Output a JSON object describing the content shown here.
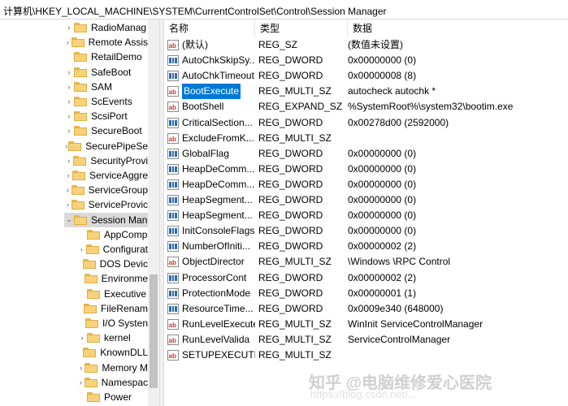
{
  "address_path": "计算机\\HKEY_LOCAL_MACHINE\\SYSTEM\\CurrentControlSet\\Control\\Session Manager",
  "tree": [
    {
      "label": "RadioManag",
      "level": 1,
      "chevron": "›"
    },
    {
      "label": "Remote Assis",
      "level": 1,
      "chevron": "›"
    },
    {
      "label": "RetailDemo",
      "level": 1,
      "chevron": ""
    },
    {
      "label": "SafeBoot",
      "level": 1,
      "chevron": "›"
    },
    {
      "label": "SAM",
      "level": 1,
      "chevron": "›"
    },
    {
      "label": "ScEvents",
      "level": 1,
      "chevron": "›"
    },
    {
      "label": "ScsiPort",
      "level": 1,
      "chevron": "›"
    },
    {
      "label": "SecureBoot",
      "level": 1,
      "chevron": "›"
    },
    {
      "label": "SecurePipeSe",
      "level": 1,
      "chevron": "›"
    },
    {
      "label": "SecurityProvi",
      "level": 1,
      "chevron": "›"
    },
    {
      "label": "ServiceAggre",
      "level": 1,
      "chevron": "›"
    },
    {
      "label": "ServiceGroup",
      "level": 1,
      "chevron": "›"
    },
    {
      "label": "ServiceProvic",
      "level": 1,
      "chevron": "›"
    },
    {
      "label": "Session Man",
      "level": 1,
      "chevron": "⌄",
      "selected": true
    },
    {
      "label": "AppComp",
      "level": 2,
      "chevron": ""
    },
    {
      "label": "Configurat",
      "level": 2,
      "chevron": "›"
    },
    {
      "label": "DOS Devic",
      "level": 2,
      "chevron": ""
    },
    {
      "label": "Environme",
      "level": 2,
      "chevron": ""
    },
    {
      "label": "Executive",
      "level": 2,
      "chevron": ""
    },
    {
      "label": "FileRenam",
      "level": 2,
      "chevron": ""
    },
    {
      "label": "I/O Systen",
      "level": 2,
      "chevron": ""
    },
    {
      "label": "kernel",
      "level": 2,
      "chevron": "›"
    },
    {
      "label": "KnownDLL",
      "level": 2,
      "chevron": ""
    },
    {
      "label": "Memory M",
      "level": 2,
      "chevron": "›"
    },
    {
      "label": "Namespac",
      "level": 2,
      "chevron": "›"
    },
    {
      "label": "Power",
      "level": 2,
      "chevron": ""
    }
  ],
  "columns": {
    "name": "名称",
    "type": "类型",
    "data": "数据"
  },
  "rows": [
    {
      "name": "(默认)",
      "type": "REG_SZ",
      "data": "(数值未设置)",
      "icon": "string-value-icon"
    },
    {
      "name": "AutoChkSkipSy...",
      "type": "REG_DWORD",
      "data": "0x00000000 (0)",
      "icon": "binary-value-icon"
    },
    {
      "name": "AutoChkTimeout",
      "type": "REG_DWORD",
      "data": "0x00000008 (8)",
      "icon": "binary-value-icon"
    },
    {
      "name": "BootExecute",
      "type": "REG_MULTI_SZ",
      "data": "autocheck autochk *",
      "icon": "string-value-icon",
      "selected": true
    },
    {
      "name": "BootShell",
      "type": "REG_EXPAND_SZ",
      "data": "%SystemRoot%\\system32\\bootim.exe",
      "icon": "string-value-icon"
    },
    {
      "name": "CriticalSection...",
      "type": "REG_DWORD",
      "data": "0x00278d00 (2592000)",
      "icon": "binary-value-icon"
    },
    {
      "name": "ExcludeFromK...",
      "type": "REG_MULTI_SZ",
      "data": "",
      "icon": "string-value-icon"
    },
    {
      "name": "GlobalFlag",
      "type": "REG_DWORD",
      "data": "0x00000000 (0)",
      "icon": "binary-value-icon"
    },
    {
      "name": "HeapDeComm...",
      "type": "REG_DWORD",
      "data": "0x00000000 (0)",
      "icon": "binary-value-icon"
    },
    {
      "name": "HeapDeComm...",
      "type": "REG_DWORD",
      "data": "0x00000000 (0)",
      "icon": "binary-value-icon"
    },
    {
      "name": "HeapSegment...",
      "type": "REG_DWORD",
      "data": "0x00000000 (0)",
      "icon": "binary-value-icon"
    },
    {
      "name": "HeapSegment...",
      "type": "REG_DWORD",
      "data": "0x00000000 (0)",
      "icon": "binary-value-icon"
    },
    {
      "name": "InitConsoleFlags",
      "type": "REG_DWORD",
      "data": "0x00000000 (0)",
      "icon": "binary-value-icon"
    },
    {
      "name": "NumberOfIniti...",
      "type": "REG_DWORD",
      "data": "0x00000002 (2)",
      "icon": "binary-value-icon"
    },
    {
      "name": "ObjectDirector",
      "type": "REG_MULTI_SZ",
      "data": "\\Windows \\RPC Control",
      "icon": "string-value-icon"
    },
    {
      "name": "ProcessorCont",
      "type": "REG_DWORD",
      "data": "0x00000002 (2)",
      "icon": "binary-value-icon"
    },
    {
      "name": "ProtectionMode",
      "type": "REG_DWORD",
      "data": "0x00000001 (1)",
      "icon": "binary-value-icon"
    },
    {
      "name": "ResourceTime...",
      "type": "REG_DWORD",
      "data": "0x0009e340 (648000)",
      "icon": "binary-value-icon"
    },
    {
      "name": "RunLevelExecute",
      "type": "REG_MULTI_SZ",
      "data": "WinInit ServiceControlManager",
      "icon": "string-value-icon"
    },
    {
      "name": "RunLevelValida",
      "type": "REG_MULTI_SZ",
      "data": "ServiceControlManager",
      "icon": "string-value-icon"
    },
    {
      "name": "SETUPEXECUTE",
      "type": "REG_MULTI_SZ",
      "data": "",
      "icon": "string-value-icon"
    }
  ],
  "watermark": {
    "text": "知乎 @电脑维修爱心医院",
    "url": "https://blog.csdn.net/..."
  },
  "colors": {
    "selection": "#0078d7",
    "tree_selection": "#d9d9d9",
    "folder": "#f7d27a"
  }
}
